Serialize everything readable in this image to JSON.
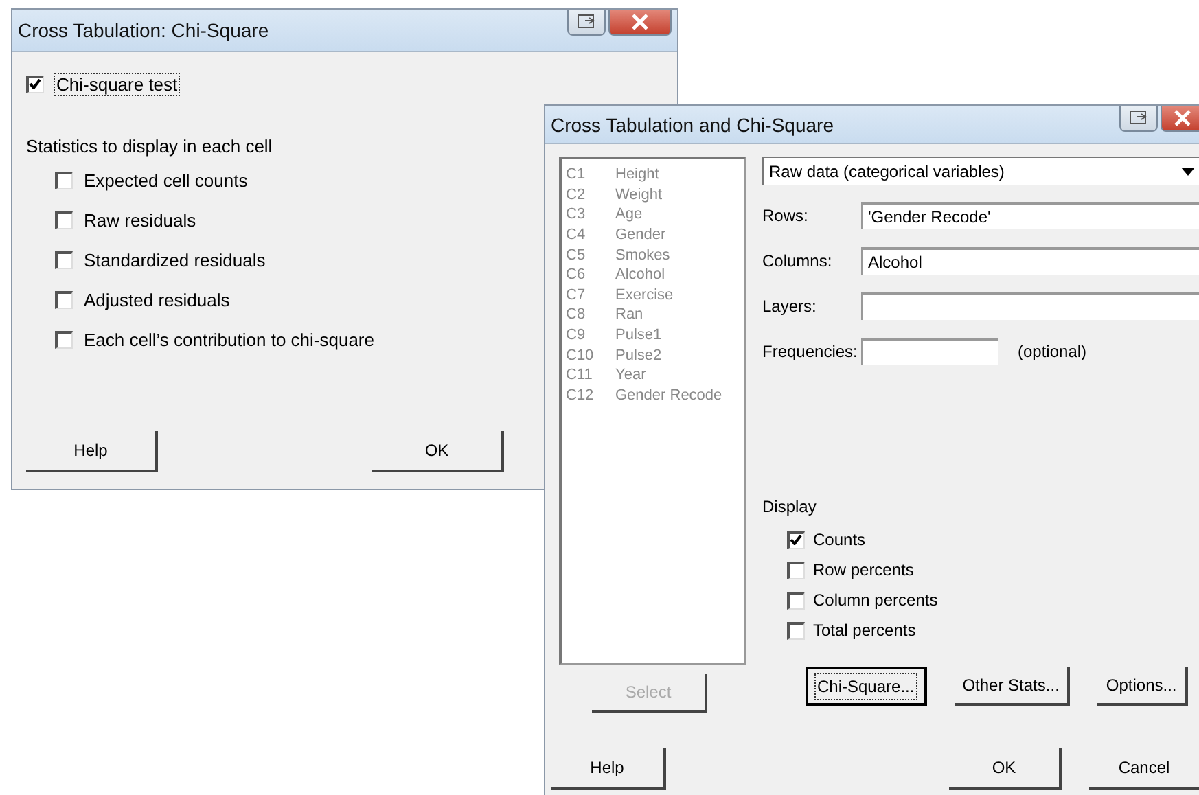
{
  "chi_square_dialog": {
    "title": "Cross Tabulation: Chi-Square",
    "test": {
      "label": "Chi-square test",
      "checked": true
    },
    "section_label": "Statistics to display in each cell",
    "options": [
      {
        "label": "Expected cell counts",
        "checked": false
      },
      {
        "label": "Raw residuals",
        "checked": false
      },
      {
        "label": "Standardized residuals",
        "checked": false
      },
      {
        "label": "Adjusted residuals",
        "checked": false
      },
      {
        "label": "Each cell’s contribution to chi-square",
        "checked": false
      }
    ],
    "buttons": [
      {
        "label": "Help",
        "kind": "left"
      },
      {
        "label": "OK",
        "kind": "right"
      }
    ]
  },
  "cross_tab_dialog": {
    "title": "Cross Tabulation and Chi-Square",
    "variables": [
      {
        "column": "C1",
        "name": "Height"
      },
      {
        "column": "C2",
        "name": "Weight"
      },
      {
        "column": "C3",
        "name": "Age"
      },
      {
        "column": "C4",
        "name": "Gender"
      },
      {
        "column": "C5",
        "name": "Smokes"
      },
      {
        "column": "C6",
        "name": "Alcohol"
      },
      {
        "column": "C7",
        "name": "Exercise"
      },
      {
        "column": "C8",
        "name": "Ran"
      },
      {
        "column": "C9",
        "name": "Pulse1"
      },
      {
        "column": "C10",
        "name": "Pulse2"
      },
      {
        "column": "C11",
        "name": "Year"
      },
      {
        "column": "C12",
        "name": "Gender Recode"
      }
    ],
    "data_type": "Raw data (categorical variables)",
    "fields": [
      {
        "label": "Rows:",
        "value": "'Gender Recode'",
        "kind": "wide"
      },
      {
        "label": "Columns:",
        "value": "Alcohol",
        "kind": "wide"
      },
      {
        "label": "Layers:",
        "kind": "wide"
      },
      {
        "label": "Frequencies:",
        "kind": "short",
        "note": "(optional)"
      }
    ],
    "display_label": "Display",
    "display": [
      {
        "label": "Counts",
        "checked": true
      },
      {
        "label": "Row percents",
        "checked": false
      },
      {
        "label": "Column percents",
        "checked": false
      },
      {
        "label": "Total percents",
        "checked": false
      }
    ],
    "select_button": {
      "label": "Select",
      "disabled": true
    },
    "sub_buttons": [
      {
        "label": "Chi-Square...",
        "focused": true
      },
      {
        "label": "Other Stats...",
        "focused": false
      },
      {
        "label": "Options...",
        "focused": false
      }
    ],
    "bottom_buttons": [
      {
        "label": "Help",
        "kind": "left"
      },
      {
        "label": "OK",
        "kind": "right"
      },
      {
        "label": "Cancel",
        "kind": "right"
      }
    ]
  }
}
